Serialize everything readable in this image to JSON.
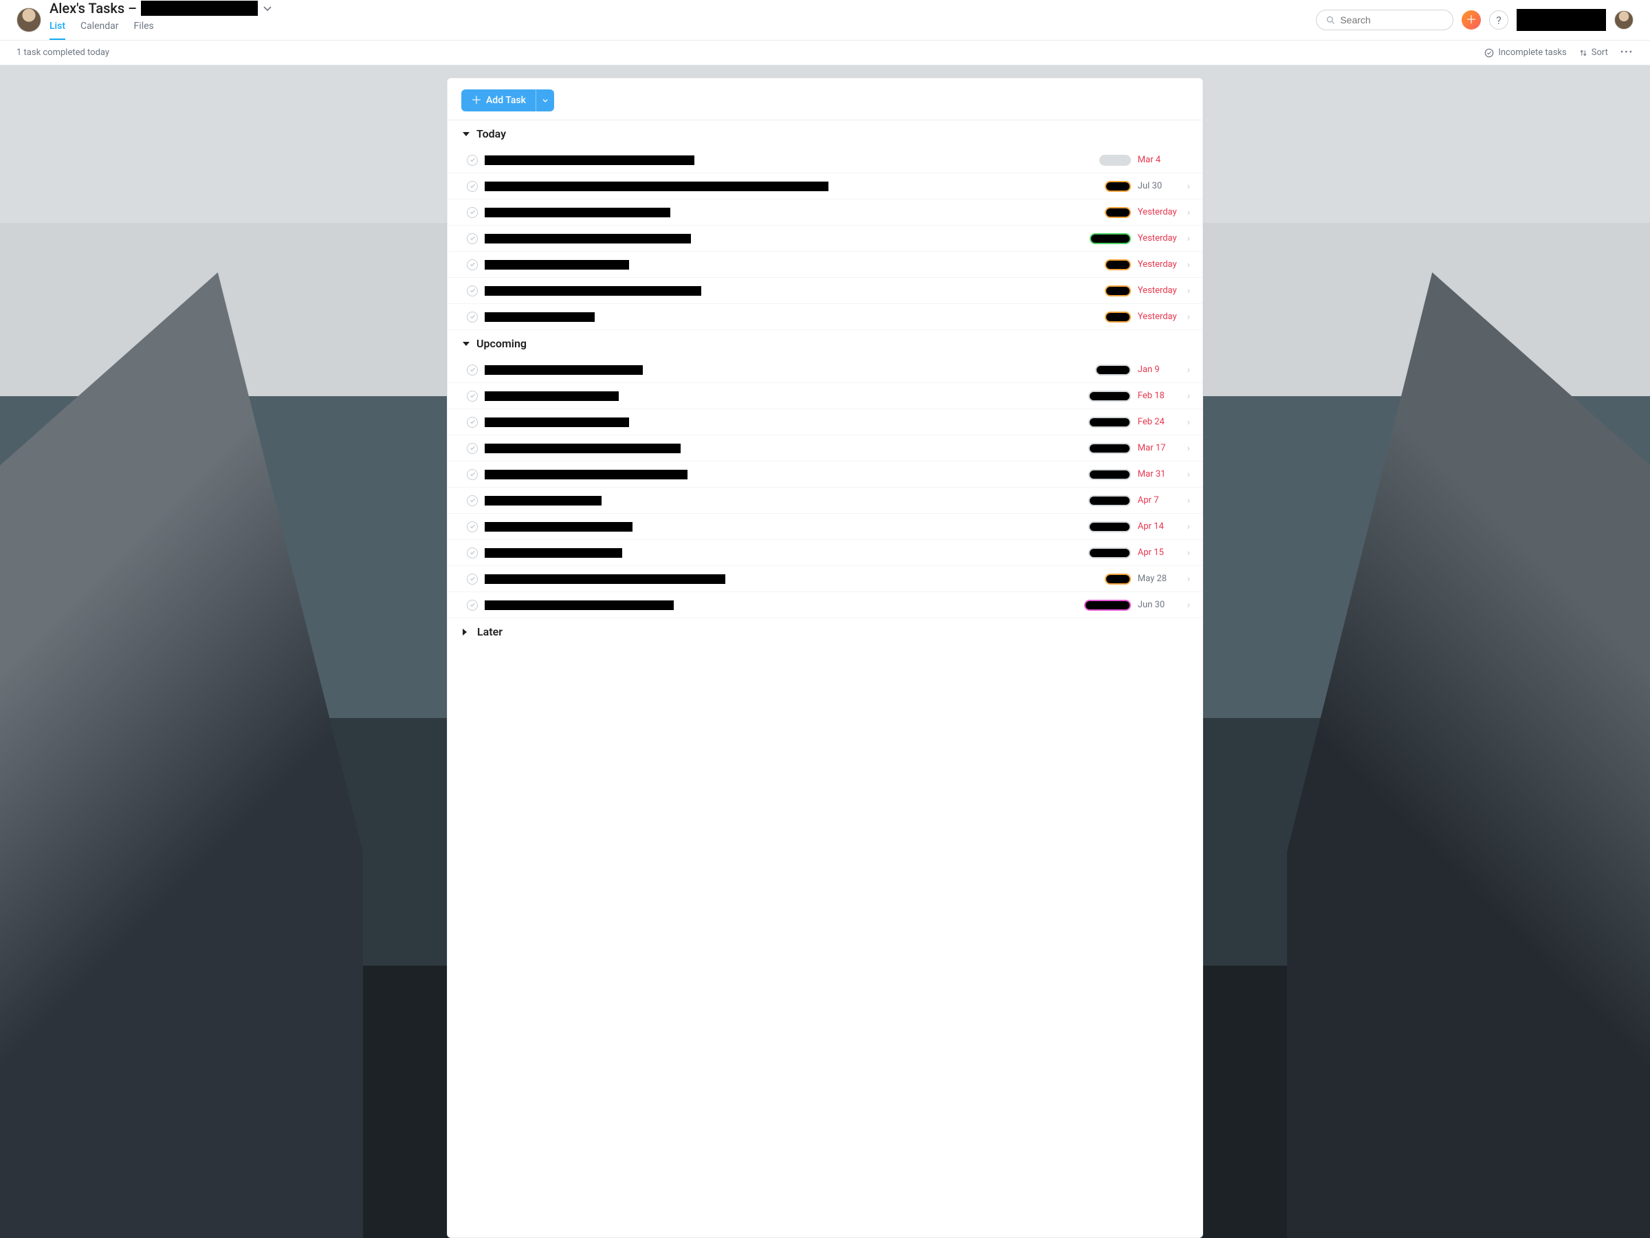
{
  "header": {
    "title_prefix": "Alex's Tasks –",
    "tabs": {
      "list": "List",
      "calendar": "Calendar",
      "files": "Files"
    },
    "search_placeholder": "Search"
  },
  "toolbar": {
    "status": "1 task completed today",
    "filter": "Incomplete tasks",
    "sort": "Sort"
  },
  "add_task_label": "Add Task",
  "sections": [
    {
      "name": "Today",
      "open": true,
      "tasks": [
        {
          "title_w": 305,
          "pill": "grey",
          "pill_w": 46,
          "due": "Mar 4",
          "due_color": "red",
          "chev": false
        },
        {
          "title_w": 500,
          "pill": "orange",
          "pill_w": 38,
          "due": "Jul 30",
          "due_color": "grey",
          "chev": true
        },
        {
          "title_w": 270,
          "pill": "orange",
          "pill_w": 38,
          "due": "Yesterday",
          "due_color": "red",
          "chev": true
        },
        {
          "title_w": 300,
          "pill": "green",
          "pill_w": 60,
          "due": "Yesterday",
          "due_color": "red",
          "chev": true
        },
        {
          "title_w": 210,
          "pill": "orange",
          "pill_w": 38,
          "due": "Yesterday",
          "due_color": "red",
          "chev": true
        },
        {
          "title_w": 315,
          "pill": "orange",
          "pill_w": 38,
          "due": "Yesterday",
          "due_color": "red",
          "chev": true
        },
        {
          "title_w": 160,
          "pill": "orange",
          "pill_w": 38,
          "due": "Yesterday",
          "due_color": "red",
          "chev": true
        }
      ]
    },
    {
      "name": "Upcoming",
      "open": true,
      "tasks": [
        {
          "title_w": 230,
          "pill": "greyfill",
          "pill_w": 52,
          "due": "Jan 9",
          "due_color": "red",
          "chev": true
        },
        {
          "title_w": 195,
          "pill": "greyfill",
          "pill_w": 62,
          "due": "Feb 18",
          "due_color": "red",
          "chev": true
        },
        {
          "title_w": 210,
          "pill": "greyfill",
          "pill_w": 62,
          "due": "Feb 24",
          "due_color": "red",
          "chev": true
        },
        {
          "title_w": 285,
          "pill": "greyfill",
          "pill_w": 62,
          "due": "Mar 17",
          "due_color": "red",
          "chev": true
        },
        {
          "title_w": 295,
          "pill": "greyfill",
          "pill_w": 62,
          "due": "Mar 31",
          "due_color": "red",
          "chev": true
        },
        {
          "title_w": 170,
          "pill": "greyfill",
          "pill_w": 62,
          "due": "Apr 7",
          "due_color": "red",
          "chev": true
        },
        {
          "title_w": 215,
          "pill": "greyfill",
          "pill_w": 62,
          "due": "Apr 14",
          "due_color": "red",
          "chev": true
        },
        {
          "title_w": 200,
          "pill": "greyfill",
          "pill_w": 62,
          "due": "Apr 15",
          "due_color": "red",
          "chev": true
        },
        {
          "title_w": 350,
          "pill": "orange",
          "pill_w": 38,
          "due": "May 28",
          "due_color": "grey",
          "chev": true
        },
        {
          "title_w": 275,
          "pill": "magenta",
          "pill_w": 68,
          "due": "Jun 30",
          "due_color": "grey",
          "chev": true
        }
      ]
    },
    {
      "name": "Later",
      "open": false,
      "tasks": []
    }
  ]
}
